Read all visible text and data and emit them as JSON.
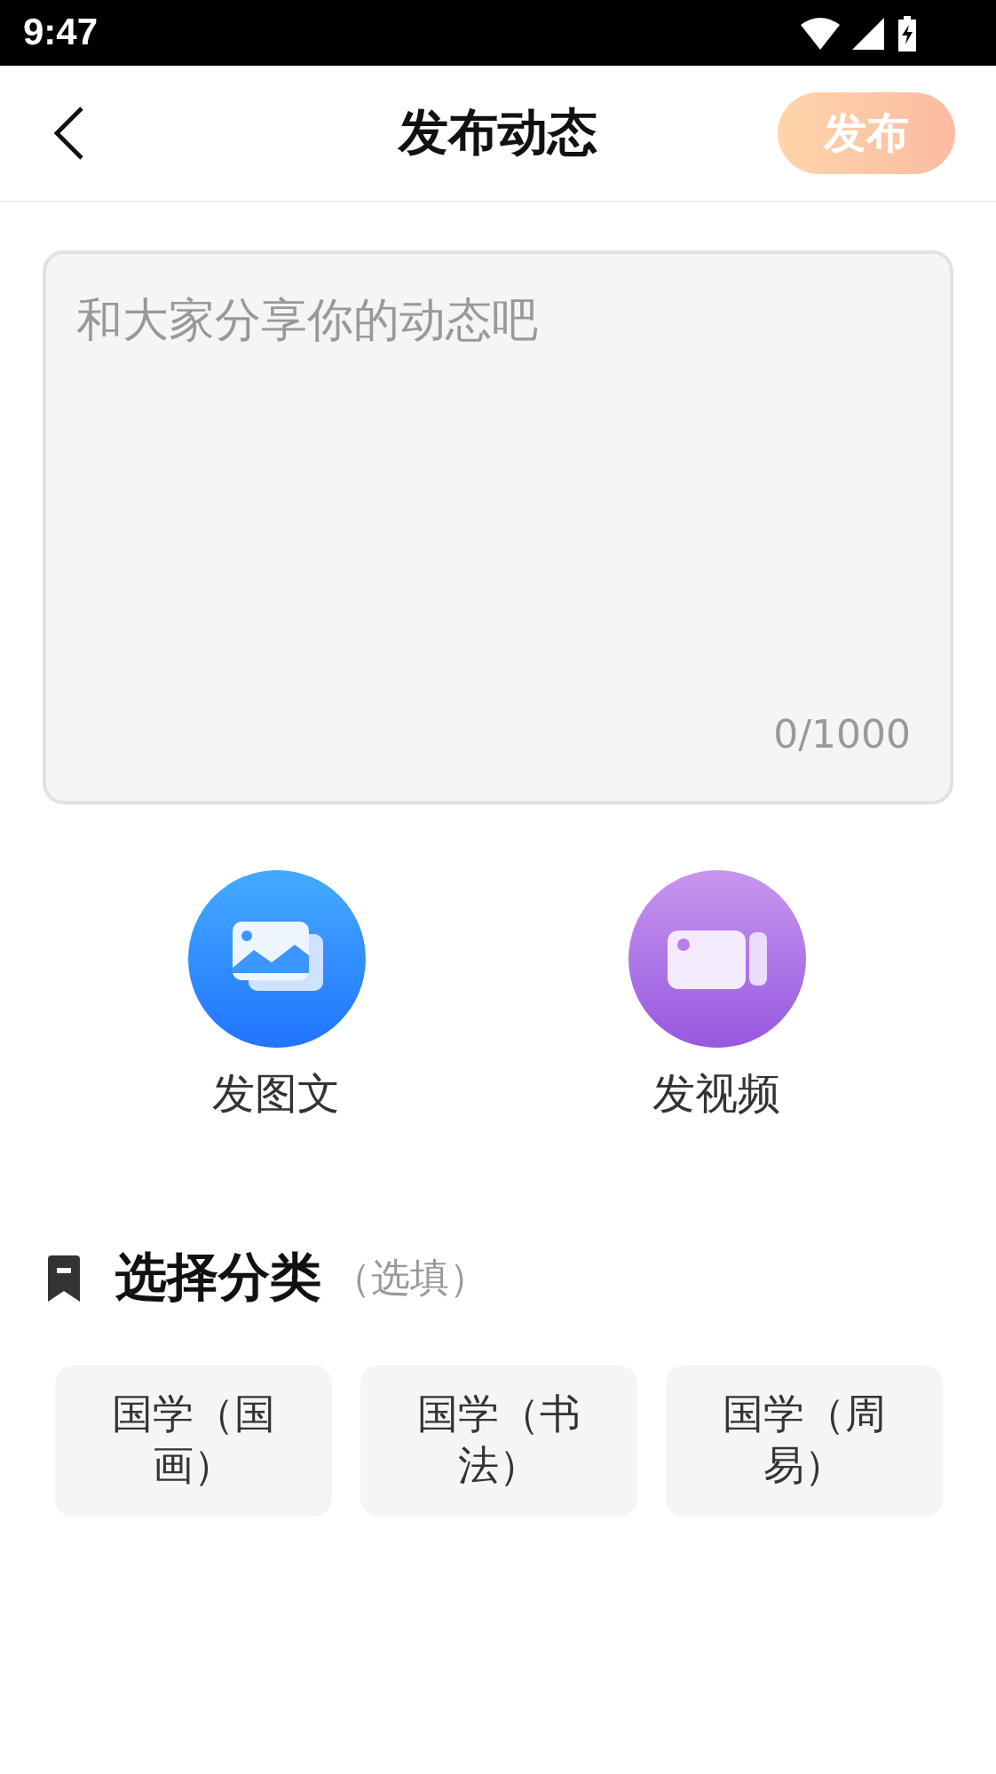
{
  "status_bar": {
    "time": "9:47"
  },
  "header": {
    "title": "发布动态",
    "publish_button": {
      "label": "发布",
      "disabled": true
    }
  },
  "post_field": {
    "placeholder": "和大家分享你的动态吧",
    "counter": "0/1000"
  },
  "actions": [
    {
      "kind": "image",
      "label": "发图文"
    },
    {
      "kind": "video",
      "label": "发视频"
    }
  ],
  "category": {
    "title": "选择分类",
    "hint": "（选填）",
    "options": [
      {
        "label": "国学（国画）",
        "selected": false
      },
      {
        "label": "国学（书法）",
        "selected": false
      },
      {
        "label": "国学（周易）",
        "selected": false
      }
    ]
  }
}
